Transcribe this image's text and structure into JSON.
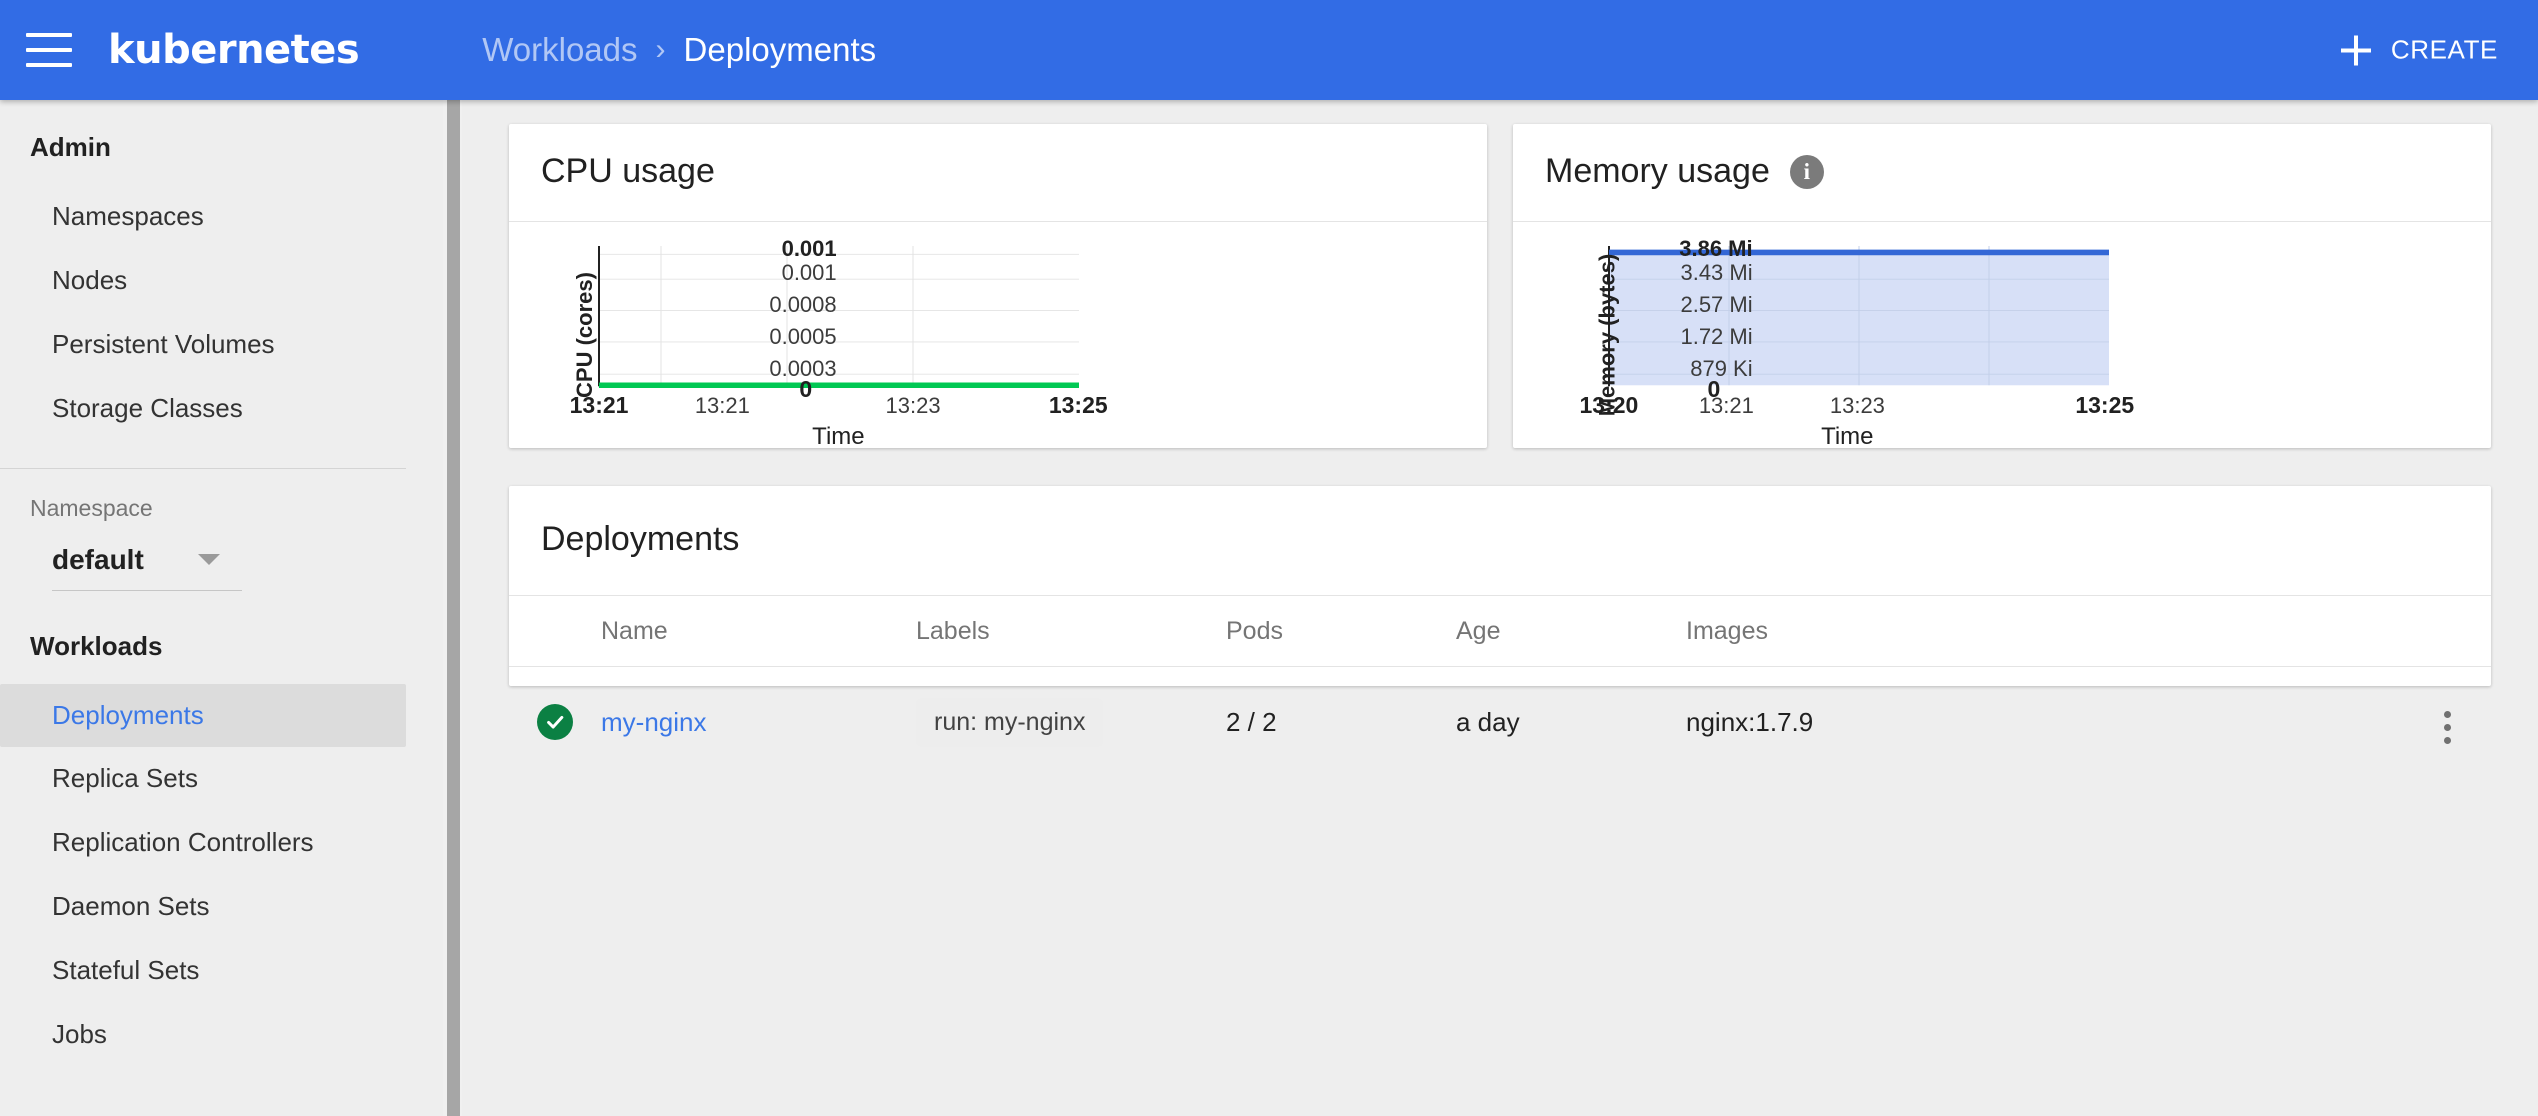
{
  "header": {
    "brand": "kubernetes",
    "menu_icon": "hamburger-icon",
    "breadcrumb": {
      "parent": "Workloads",
      "separator": "›",
      "current": "Deployments"
    },
    "create_label": "CREATE",
    "accent_color": "#326ce5"
  },
  "sidebar": {
    "admin_title": "Admin",
    "admin_items": [
      {
        "label": "Namespaces"
      },
      {
        "label": "Nodes"
      },
      {
        "label": "Persistent Volumes"
      },
      {
        "label": "Storage Classes"
      }
    ],
    "namespace_label": "Namespace",
    "namespace_value": "default",
    "workloads_title": "Workloads",
    "workload_items": [
      {
        "label": "Deployments",
        "active": true
      },
      {
        "label": "Replica Sets",
        "active": false
      },
      {
        "label": "Replication Controllers",
        "active": false
      },
      {
        "label": "Daemon Sets",
        "active": false
      },
      {
        "label": "Stateful Sets",
        "active": false
      },
      {
        "label": "Jobs",
        "active": false
      }
    ],
    "active_color": "#3b78e7"
  },
  "cpu_card": {
    "title": "CPU usage"
  },
  "memory_card": {
    "title": "Memory usage",
    "info_icon": "info-icon",
    "info_glyph": "i"
  },
  "deployments_card": {
    "title": "Deployments",
    "columns": [
      "Name",
      "Labels",
      "Pods",
      "Age",
      "Images"
    ],
    "rows": [
      {
        "status": "ok",
        "name": "my-nginx",
        "labels": [
          "run: my-nginx"
        ],
        "pods": "2 / 2",
        "age": "a day",
        "images": "nginx:1.7.9",
        "menu_icon": "kebab-menu-icon"
      }
    ]
  },
  "chart_data": [
    {
      "type": "line",
      "title": "CPU usage",
      "xlabel": "Time",
      "ylabel": "CPU (cores)",
      "x_ticks": [
        "13:21",
        "13:21",
        "13:23",
        "13:25"
      ],
      "x_tick_bold": [
        true,
        false,
        false,
        true
      ],
      "y_ticks": [
        "0.001",
        "0.001",
        "0.0008",
        "0.0005",
        "0.0003",
        "0"
      ],
      "y_tick_bold": [
        true,
        false,
        false,
        false,
        false,
        true
      ],
      "ylim": [
        0,
        0.001
      ],
      "series": [
        {
          "name": "CPU (cores)",
          "values": [
            0,
            0,
            0,
            0,
            0
          ],
          "color": "#00c853"
        }
      ],
      "grid": true,
      "legend": "none"
    },
    {
      "type": "area",
      "title": "Memory usage",
      "xlabel": "Time",
      "ylabel": "Memory (bytes)",
      "x_ticks": [
        "13:20",
        "13:21",
        "13:23",
        "13:25"
      ],
      "x_tick_bold": [
        true,
        false,
        false,
        true
      ],
      "y_ticks": [
        "3.86 Mi",
        "3.43 Mi",
        "2.57 Mi",
        "1.72 Mi",
        "879 Ki",
        "0"
      ],
      "y_tick_bold": [
        true,
        false,
        false,
        false,
        false,
        true
      ],
      "ylim": [
        0,
        4046848
      ],
      "series": [
        {
          "name": "Memory (bytes)",
          "values": [
            3596615,
            3596615,
            3596615,
            3596615,
            3596615
          ],
          "color": "#3367d6",
          "fill": "#d7e0f7"
        }
      ],
      "grid": true,
      "legend": "none"
    }
  ]
}
